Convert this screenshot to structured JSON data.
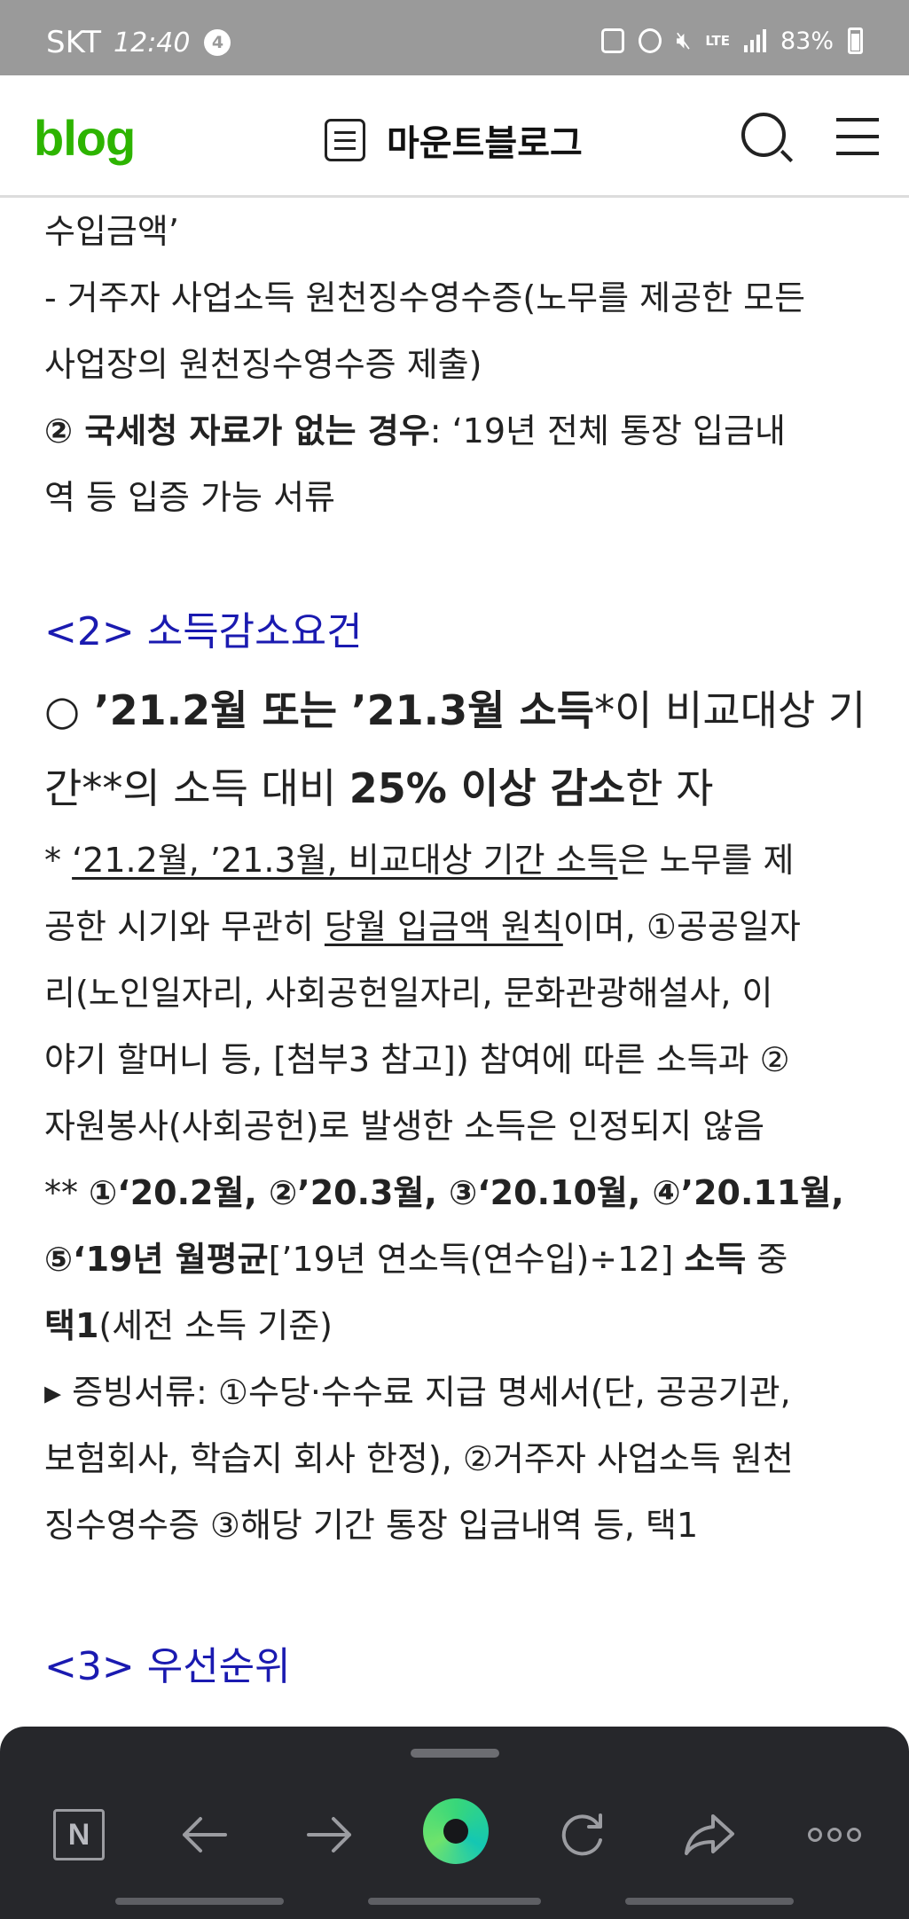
{
  "status_bar": {
    "carrier": "SKT",
    "time": "12:40",
    "notification_count": "4",
    "network": "LTE",
    "battery": "83%"
  },
  "header": {
    "logo": "blog",
    "title": "마운트블로그",
    "icons": [
      "list-icon",
      "search-icon",
      "menu-icon"
    ]
  },
  "article": {
    "l1": "수입금액’",
    "l2": "- 거주자 사업소득 원천징수영수증(노무를 제공한 모든",
    "l3": "사업장의 원천징수영수증 제출)",
    "l4_bold": "② 국세청 자료가 없는 경우",
    "l4_rest": ": ‘19년 전체 통장 입금내",
    "l5": "역 등 입증 가능 서류",
    "heading2": "<2> 소득감소요건",
    "b1_bold": "○ ’21.2월 또는 ’21.3월 소득",
    "b1_rest": "*이 비교대상 기",
    "b2_a": "간**의 소득 대비 ",
    "b2_bold": "25% 이상 감소",
    "b2_c": "한 자",
    "n1_a": "* ",
    "n1_u": "‘21.2월, ’21.3월, 비교대상 기간 소득",
    "n1_c": "은 노무를 제",
    "n2_a": "공한 시기와 무관히 ",
    "n2_u": "당월 입금액 원칙",
    "n2_c": "이며, ①공공일자",
    "n3": "리(노인일자리, 사회공헌일자리, 문화관광해설사, 이",
    "n4": "야기 할머니 등, [첨부3 참고]) 참여에 따른 소득과 ②",
    "n5": "자원봉사(사회공헌)로 발생한 소득은 인정되지 않음",
    "s1_a": "** ",
    "s1_bold": "①‘20.2월, ②’20.3월, ③‘20.10월, ④’20.11월,",
    "s2_bold1": "⑤‘19년 월평균",
    "s2_mid": "[’19년 연소득(연수입)÷12] ",
    "s2_bold2": "소득",
    "s2_end": " 중",
    "s3_bold": "택1",
    "s3_rest": "(세전 소득 기준)",
    "p1": "▸ 증빙서류: ①수당·수수료 지급 명세서(단, 공공기관,",
    "p2": "보험회사, 학습지 회사 한정), ②거주자 사업소득 원천",
    "p3": "징수영수증 ③해당 기간 통장 입금내역 등, 택1",
    "heading3": "<3> 우선순위"
  },
  "toolbar": {
    "n_label": "N",
    "icons": [
      "naver-n-icon",
      "back-arrow-icon",
      "forward-arrow-icon",
      "green-dot-icon",
      "refresh-icon",
      "share-icon",
      "more-icon"
    ]
  },
  "colors": {
    "logo_green": "#2db400",
    "heading_blue": "#1a1ab0",
    "toolbar_bg": "#26272b",
    "status_bg": "#9a9a9a"
  }
}
